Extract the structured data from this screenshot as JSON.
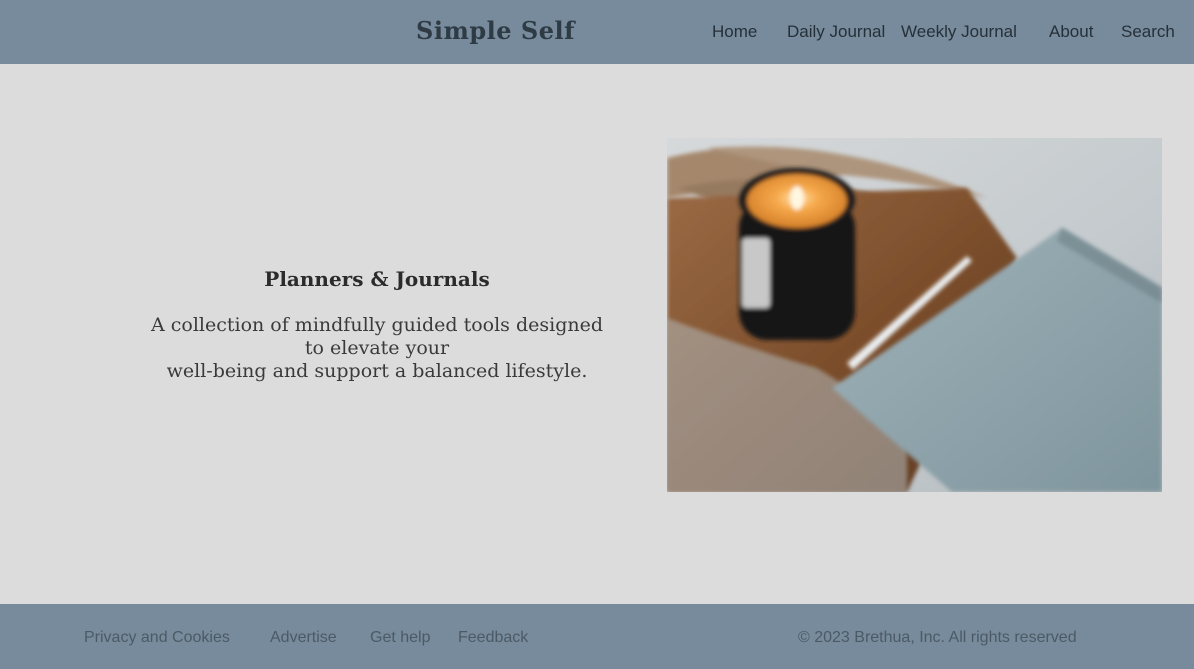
{
  "header": {
    "brand": "Simple Self",
    "nav": [
      {
        "label": "Home"
      },
      {
        "label": "Daily Journal"
      },
      {
        "label": "Weekly Journal"
      },
      {
        "label": "About"
      },
      {
        "label": "Search"
      }
    ]
  },
  "hero": {
    "title": "Planners & Journals",
    "description_lines": [
      "A collection of mindfully guided tools designed",
      "to elevate your",
      "well-being and support a balanced lifestyle."
    ],
    "image_alt": "candle-and-journal-photo"
  },
  "footer": {
    "links": [
      {
        "label": "Privacy and Cookies"
      },
      {
        "label": "Advertise"
      },
      {
        "label": "Get help"
      },
      {
        "label": "Feedback"
      }
    ],
    "copyright": "© 2023 Brethua, Inc. All rights reserved"
  },
  "colors": {
    "header_bg": "#778b9c",
    "page_bg": "#dcdcdc",
    "footer_bg": "#778b9c"
  }
}
